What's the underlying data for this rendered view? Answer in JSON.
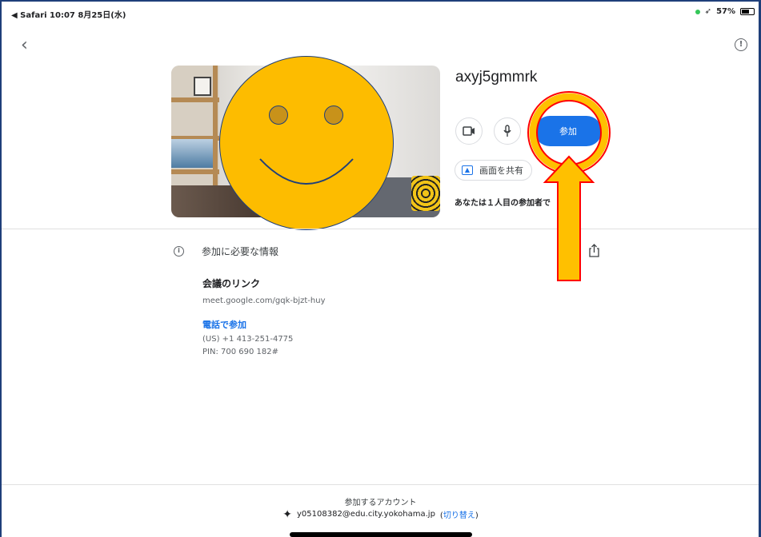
{
  "status_bar": {
    "left": "◀ Safari  10:07  8月25日(水)",
    "right": "57%"
  },
  "nav": {
    "back_icon": "chevron-left-icon",
    "info_icon": "report-icon"
  },
  "meeting": {
    "code": "axyj5gmmrk",
    "join_label": "参加",
    "share_screen_label": "画面を共有",
    "first_participant_note": "あなたは１人目の参加者で"
  },
  "info": {
    "title": "参加に必要な情報",
    "link_label": "会議のリンク",
    "link_url": "meet.google.com/gqk-bjzt-huy",
    "phone_label": "電話で参加",
    "phone_number": "(US) +1 413-251-4775",
    "pin": "PIN: 700 690 182#"
  },
  "account": {
    "label": "参加するアカウント",
    "email": "y05108382@edu.city.yokohama.jp",
    "switch_open": "(",
    "switch_label": "切り替え",
    "switch_close": ")"
  },
  "colors": {
    "accent": "#1a73e8",
    "smiley": "#fdbc00",
    "highlight_ring": "#ff0000",
    "arrow_fill": "#ffc000"
  }
}
